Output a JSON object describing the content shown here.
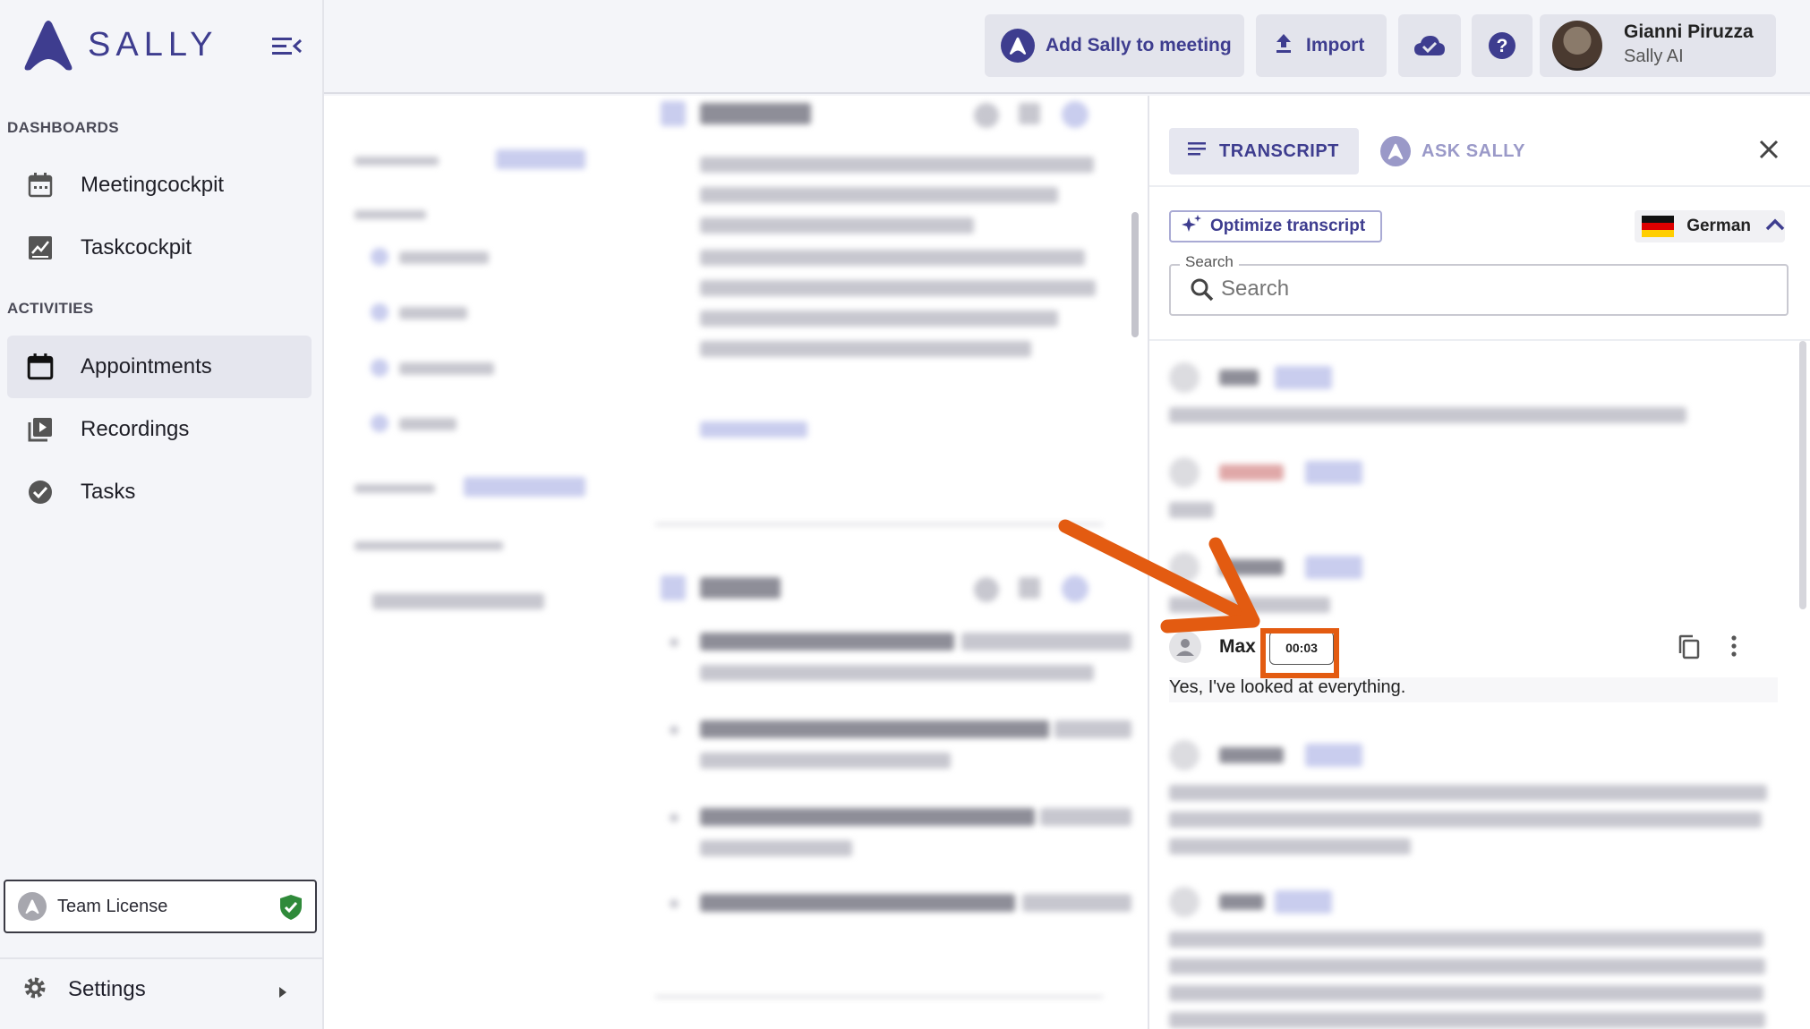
{
  "app": {
    "brand": "SALLY",
    "accent": "#3e3d8f"
  },
  "sidebar": {
    "sections": [
      {
        "label": "DASHBOARDS"
      },
      {
        "label": "ACTIVITIES"
      }
    ],
    "items": [
      {
        "label": "Meetingcockpit",
        "icon": "calendar-icon"
      },
      {
        "label": "Taskcockpit",
        "icon": "chart-icon"
      },
      {
        "label": "Appointments",
        "icon": "calendar-icon",
        "active": true
      },
      {
        "label": "Recordings",
        "icon": "video-library-icon"
      },
      {
        "label": "Tasks",
        "icon": "check-circle-icon"
      }
    ],
    "license": {
      "label": "Team License"
    },
    "settings": {
      "label": "Settings"
    }
  },
  "topbar": {
    "add_sally": "Add Sally to meeting",
    "import": "Import",
    "user": {
      "name": "Gianni Piruzza",
      "org": "Sally AI"
    }
  },
  "transcript_panel": {
    "tab_transcript": "TRANSCRIPT",
    "tab_ask": "ASK SALLY",
    "optimize": "Optimize transcript",
    "language": "German",
    "search_label": "Search",
    "search_placeholder": "Search",
    "focused_message": {
      "speaker": "Max",
      "time": "00:03",
      "text": "Yes, I've looked at everything."
    }
  },
  "annotation_color": "#e35b11"
}
